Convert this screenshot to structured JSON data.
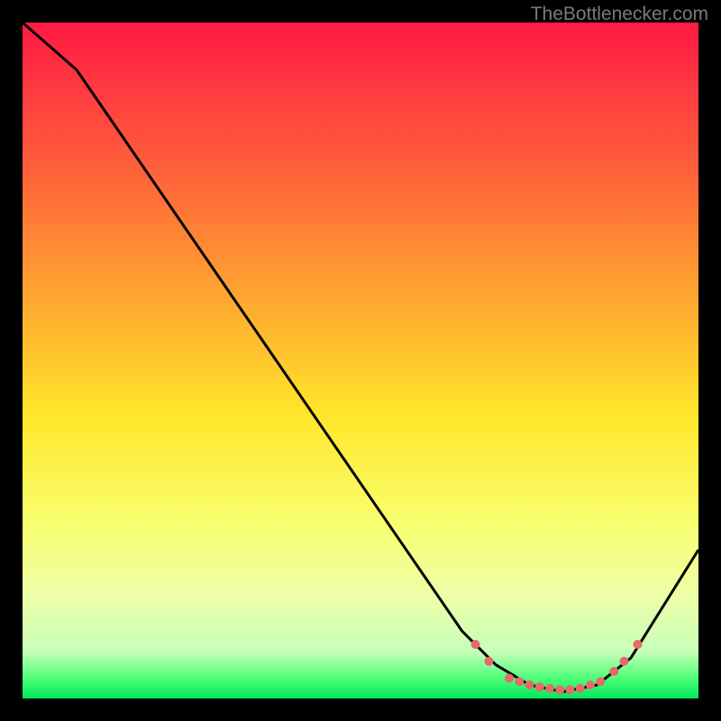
{
  "watermark": "TheBottlenecker.com",
  "chart_data": {
    "type": "line",
    "title": "",
    "xlabel": "",
    "ylabel": "",
    "xlim": [
      0,
      100
    ],
    "ylim": [
      0,
      100
    ],
    "background_gradient": {
      "stops": [
        {
          "offset": 0,
          "color": "#ff1a44"
        },
        {
          "offset": 20,
          "color": "#ff5a3c"
        },
        {
          "offset": 40,
          "color": "#ffa330"
        },
        {
          "offset": 58,
          "color": "#ffe62a"
        },
        {
          "offset": 74,
          "color": "#f8ff6e"
        },
        {
          "offset": 85,
          "color": "#ecffa8"
        },
        {
          "offset": 93,
          "color": "#c8ffb8"
        },
        {
          "offset": 97,
          "color": "#4eff7a"
        },
        {
          "offset": 100,
          "color": "#00e85a"
        }
      ]
    },
    "series": [
      {
        "name": "curve",
        "color": "#000000",
        "width": 1.5,
        "points": [
          {
            "x": 0,
            "y": 100
          },
          {
            "x": 8,
            "y": 93
          },
          {
            "x": 65,
            "y": 10
          },
          {
            "x": 70,
            "y": 5
          },
          {
            "x": 75,
            "y": 2
          },
          {
            "x": 80,
            "y": 1
          },
          {
            "x": 85,
            "y": 2
          },
          {
            "x": 90,
            "y": 6
          },
          {
            "x": 100,
            "y": 22
          }
        ]
      }
    ],
    "markers": {
      "color": "#e66a6a",
      "radius": 5,
      "points": [
        {
          "x": 67,
          "y": 8
        },
        {
          "x": 69,
          "y": 5.5
        },
        {
          "x": 72,
          "y": 3
        },
        {
          "x": 73.5,
          "y": 2.5
        },
        {
          "x": 75,
          "y": 2
        },
        {
          "x": 76.5,
          "y": 1.7
        },
        {
          "x": 78,
          "y": 1.5
        },
        {
          "x": 79.5,
          "y": 1.3
        },
        {
          "x": 81,
          "y": 1.3
        },
        {
          "x": 82.5,
          "y": 1.5
        },
        {
          "x": 84,
          "y": 2
        },
        {
          "x": 85.5,
          "y": 2.5
        },
        {
          "x": 87.5,
          "y": 4
        },
        {
          "x": 89,
          "y": 5.5
        },
        {
          "x": 91,
          "y": 8
        }
      ]
    }
  }
}
